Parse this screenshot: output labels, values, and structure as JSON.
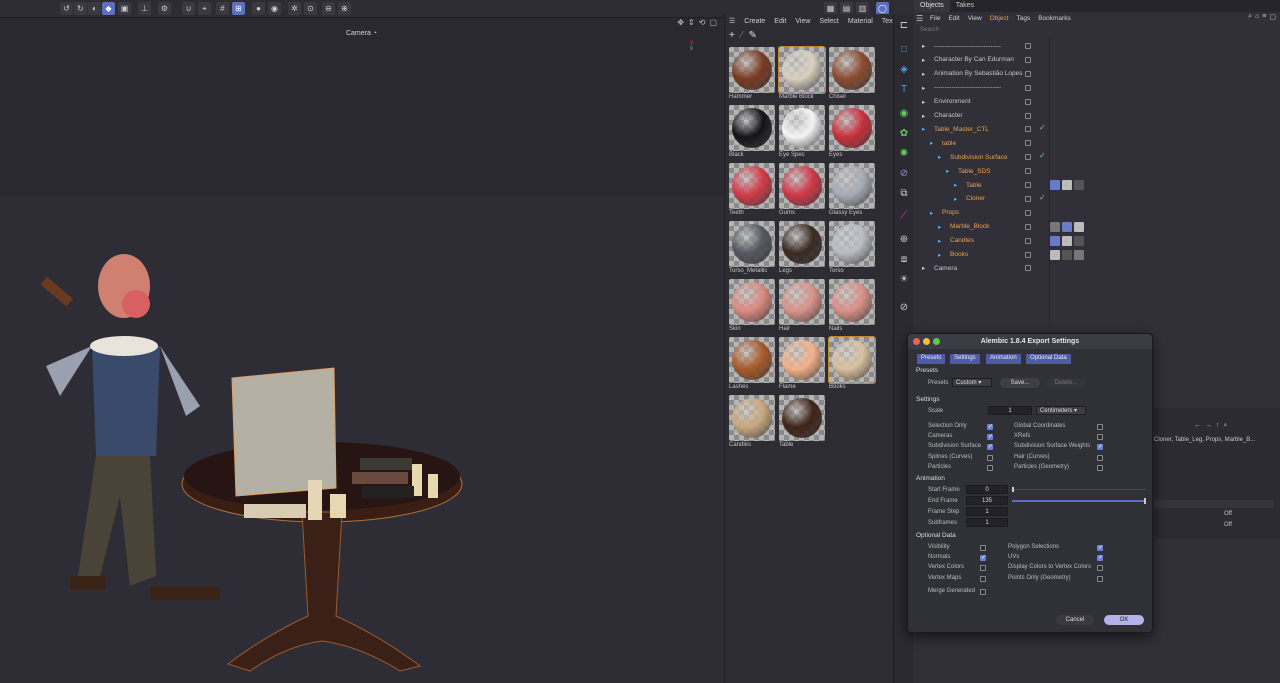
{
  "toolbar": {
    "icons": [
      "undo-icon",
      "redo-icon",
      "cube-icon",
      "render-icon"
    ]
  },
  "viewport": {
    "title": "Camera"
  },
  "materials": {
    "menu": [
      "Create",
      "Edit",
      "View",
      "Select",
      "Material",
      "Texture"
    ],
    "items": [
      {
        "name": "Hammer",
        "color": "#7a3a22"
      },
      {
        "name": "Marble Block",
        "color": "#d9cfc0"
      },
      {
        "name": "Chisel",
        "color": "#8a4a30"
      },
      {
        "name": "Black",
        "color": "#141418"
      },
      {
        "name": "Eye Spec",
        "color": "#f4f4f4"
      },
      {
        "name": "Eyes",
        "color": "#c9303c"
      },
      {
        "name": "Teeth",
        "color": "#d23a48"
      },
      {
        "name": "Gums",
        "color": "#cf3848"
      },
      {
        "name": "Glassy Eyes",
        "color": "#a8acb4"
      },
      {
        "name": "Torso_Metallic",
        "color": "#555860"
      },
      {
        "name": "Legs",
        "color": "#3a2a22"
      },
      {
        "name": "Torso",
        "color": "#b9bcc4"
      },
      {
        "name": "Skin",
        "color": "#d98a80"
      },
      {
        "name": "Hair",
        "color": "#d7948a"
      },
      {
        "name": "Nails",
        "color": "#d99088"
      },
      {
        "name": "Lashes",
        "color": "#a85a2a"
      },
      {
        "name": "Flame",
        "color": "#f3b08a"
      },
      {
        "name": "Books",
        "color": "#d8c0a0"
      },
      {
        "name": "Candles",
        "color": "#c8a880"
      },
      {
        "name": "Table",
        "color": "#3e2418"
      }
    ]
  },
  "objects": {
    "tabs": [
      "Objects",
      "Takes"
    ],
    "menu": [
      "File",
      "Edit",
      "View",
      "Object",
      "Tags",
      "Bookmarks"
    ],
    "search_placeholder": "Search",
    "rows": [
      {
        "name": "-------------------------------",
        "indent": 0,
        "orange": false
      },
      {
        "name": "Character By Can Edurman",
        "indent": 0,
        "orange": false
      },
      {
        "name": "Animation By Sebastião Lopes",
        "indent": 0,
        "orange": false
      },
      {
        "name": "-------------------------------",
        "indent": 0,
        "orange": false
      },
      {
        "name": "Environment",
        "indent": 0,
        "orange": false
      },
      {
        "name": "Character",
        "indent": 0,
        "orange": false
      },
      {
        "name": "Table_Master_CTL",
        "indent": 0,
        "orange": true
      },
      {
        "name": "table",
        "indent": 1,
        "orange": true
      },
      {
        "name": "Subdivision Surface",
        "indent": 2,
        "orange": true
      },
      {
        "name": "Table_SDS",
        "indent": 3,
        "orange": true
      },
      {
        "name": "Table",
        "indent": 4,
        "orange": true
      },
      {
        "name": "Cloner",
        "indent": 4,
        "orange": true
      },
      {
        "name": "Props",
        "indent": 1,
        "orange": true
      },
      {
        "name": "Marble_Block",
        "indent": 2,
        "orange": true
      },
      {
        "name": "Candles",
        "indent": 2,
        "orange": true
      },
      {
        "name": "Books",
        "indent": 2,
        "orange": true
      },
      {
        "name": "Camera",
        "indent": 0,
        "orange": false
      }
    ],
    "attr_text": "Cloner, Table_Leg, Props, Marble_B...",
    "attr_off1": "Off",
    "attr_off2": "Off"
  },
  "dialog": {
    "title": "Alembic 1.8.4 Export Settings",
    "tabs": [
      "Presets",
      "Settings",
      "Animation",
      "Optional Data"
    ],
    "presets_heading": "Presets",
    "presets_label": "Presets",
    "presets_value": "Custom",
    "save_label": "Save...",
    "delete_label": "Delete...",
    "settings_heading": "Settings",
    "scale_label": "Scale",
    "scale_value": "1",
    "scale_unit": "Centimeters",
    "settings_left": [
      {
        "label": "Selection Only",
        "checked": true
      },
      {
        "label": "Cameras",
        "checked": true
      },
      {
        "label": "Subdivision Surface",
        "checked": true
      },
      {
        "label": "Splines (Curves)",
        "checked": false
      },
      {
        "label": "Particles",
        "checked": false
      }
    ],
    "settings_right": [
      {
        "label": "Global Coordinates",
        "checked": false
      },
      {
        "label": "XRefs",
        "checked": false
      },
      {
        "label": "Subdivision Surface Weights",
        "checked": true
      },
      {
        "label": "Hair (Curves)",
        "checked": false
      },
      {
        "label": "Particles (Geometry)",
        "checked": false
      }
    ],
    "animation_heading": "Animation",
    "start_frame_label": "Start Frame",
    "start_frame": "0",
    "end_frame_label": "End Frame",
    "end_frame": "135",
    "frame_step_label": "Frame Step",
    "frame_step": "1",
    "subframes_label": "Subframes",
    "subframes": "1",
    "optional_heading": "Optional Data",
    "optional_left": [
      {
        "label": "Visibility",
        "checked": false
      },
      {
        "label": "Normals",
        "checked": true
      },
      {
        "label": "Vertex Colors",
        "checked": false
      },
      {
        "label": "Vertex Maps",
        "checked": false
      }
    ],
    "optional_right": [
      {
        "label": "Polygon Selections",
        "checked": true
      },
      {
        "label": "UVs",
        "checked": true
      },
      {
        "label": "Display Colors to Vertex Colors",
        "checked": false
      },
      {
        "label": "Points Only (Geometry)",
        "checked": false
      }
    ],
    "merge_label": "Merge Generated",
    "merge_checked": false,
    "cancel_label": "Cancel",
    "ok_label": "OK"
  }
}
